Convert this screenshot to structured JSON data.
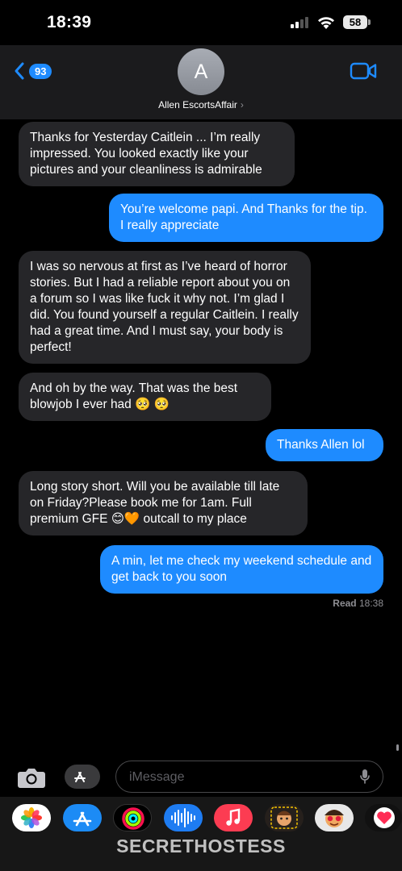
{
  "status_bar": {
    "time": "18:39",
    "battery": "58"
  },
  "header": {
    "back_count": "93",
    "avatar_initial": "A",
    "contact_name": "Allen EscortsAffair",
    "contact_chevron": "›"
  },
  "messages": [
    {
      "direction": "incoming",
      "text": "Thanks for Yesterday Caitlein ... I’m really impressed. You looked exactly like your pictures and your cleanliness is admirable"
    },
    {
      "direction": "outgoing",
      "text": "You’re welcome papi. And Thanks for the tip. I really appreciate"
    },
    {
      "direction": "incoming",
      "text": "I was so nervous at first as I’ve heard of horror stories. But I had a reliable report about you on a forum so I was like fuck it why not. I’m glad I did.  You found yourself a regular Caitlein. I really had a great time. And I must say, your body is perfect!"
    },
    {
      "direction": "incoming",
      "text": "And oh by the way. That was the best blowjob I ever had 🥺 🥺"
    },
    {
      "direction": "outgoing",
      "text": "Thanks Allen lol"
    },
    {
      "direction": "incoming",
      "text": "Long story short. Will you be available till late on Friday?Please book me for 1am. Full premium GFE 😊🧡 outcall to my place"
    },
    {
      "direction": "outgoing",
      "text": "A min, let me check my weekend schedule and get back to you soon"
    }
  ],
  "read_receipt": {
    "label": "Read",
    "time": "18:38"
  },
  "composer": {
    "placeholder": "iMessage"
  },
  "app_drawer": {
    "apps": [
      "photos-app",
      "app-store-app",
      "activity-app",
      "voice-memos-app",
      "music-app",
      "memoji-app",
      "memoji-stickers-app",
      "digital-touch-app"
    ]
  },
  "watermark": "SECRETHOSTESS",
  "colors": {
    "outgoing_bubble": "#1e8bff",
    "incoming_bubble": "#262629",
    "background": "#000000"
  }
}
